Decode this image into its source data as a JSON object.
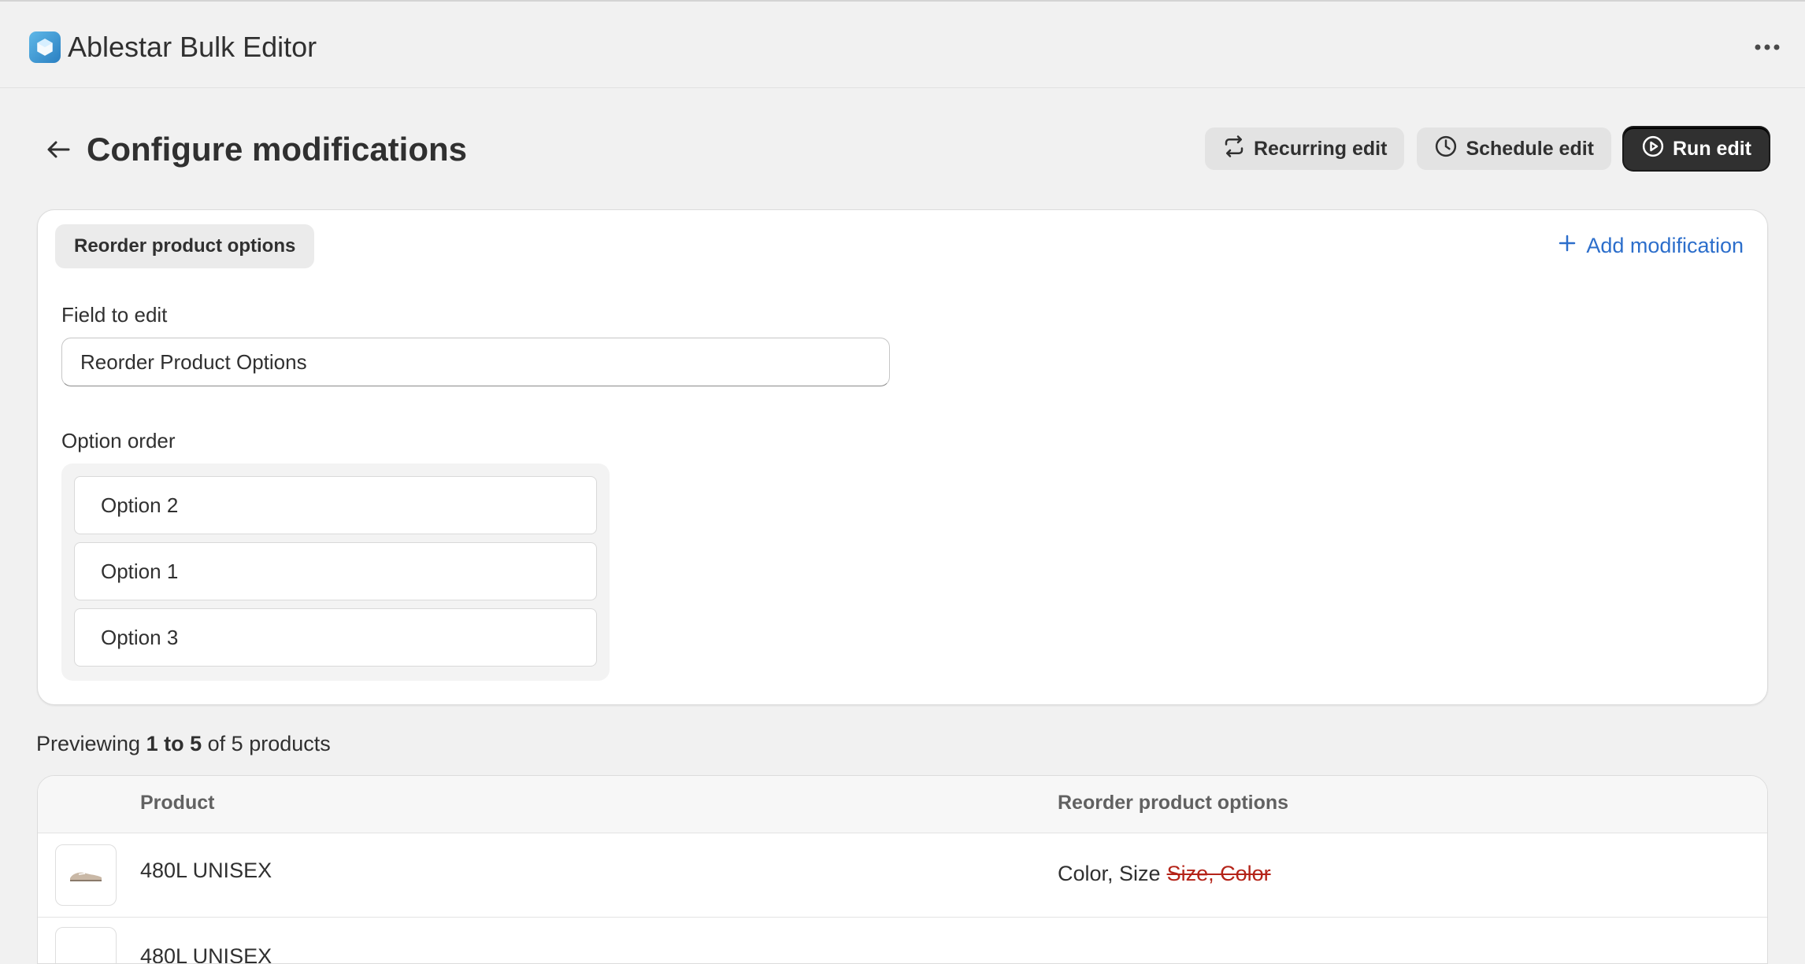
{
  "app": {
    "title": "Ablestar Bulk Editor",
    "logo_icon": "cube-icon",
    "menu_icon": "more-horizontal-icon"
  },
  "page": {
    "title": "Configure modifications",
    "back_icon": "arrow-left-icon"
  },
  "actions": {
    "recurring_label": "Recurring edit",
    "schedule_label": "Schedule edit",
    "run_label": "Run edit"
  },
  "modification": {
    "tab_label": "Reorder product options",
    "add_label": "Add modification",
    "field_label": "Field to edit",
    "field_value": "Reorder Product Options",
    "option_order_label": "Option order",
    "options": [
      "Option 2",
      "Option 1",
      "Option 3"
    ]
  },
  "preview": {
    "prefix": "Previewing",
    "range": "1 to 5",
    "middle": "of",
    "suffix": "5 products"
  },
  "table": {
    "columns": [
      "Product",
      "Reorder product options"
    ],
    "rows": [
      {
        "product": "480L UNISEX",
        "new_value": "Color, Size",
        "old_value": "Size, Color"
      },
      {
        "product": "480L UNISEX",
        "new_value": "",
        "old_value": ""
      }
    ]
  },
  "colors": {
    "accent": "#2c6ecb",
    "primary_button": "#303030",
    "strike": "#b42318"
  }
}
